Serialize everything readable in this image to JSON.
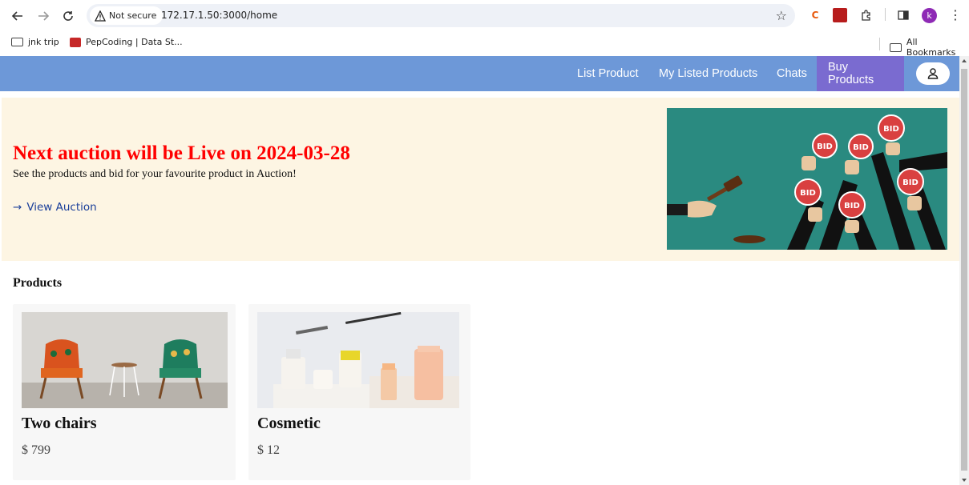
{
  "browser": {
    "security_label": "Not secure",
    "url": "172.17.1.50:3000/home",
    "profile_initial": "k",
    "bookmarks": [
      {
        "label": "jnk trip"
      },
      {
        "label": "PepCoding | Data St..."
      }
    ],
    "all_bookmarks_label": "All Bookmarks"
  },
  "nav": {
    "links": [
      {
        "label": "List Product"
      },
      {
        "label": "My Listed Products"
      },
      {
        "label": "Chats"
      },
      {
        "label": "Buy Products"
      }
    ],
    "active_link": "Buy Products"
  },
  "hero": {
    "title": "Next auction will be Live on 2024-03-28",
    "subtitle": "See the products and bid for your favourite product in Auction!",
    "link_label": "View Auction",
    "image_bid_text": "BID"
  },
  "products": {
    "heading": "Products",
    "items": [
      {
        "name": "Two chairs",
        "price": "$ 799"
      },
      {
        "name": "Cosmetic",
        "price": "$ 12"
      }
    ]
  },
  "colors": {
    "navbar": "#6d98d8",
    "active_nav": "#7a6bd0",
    "hero_bg": "#fdf5e3",
    "hero_title": "#ff0000",
    "link": "#1a3f9a",
    "card_bg": "#f7f7f7"
  }
}
